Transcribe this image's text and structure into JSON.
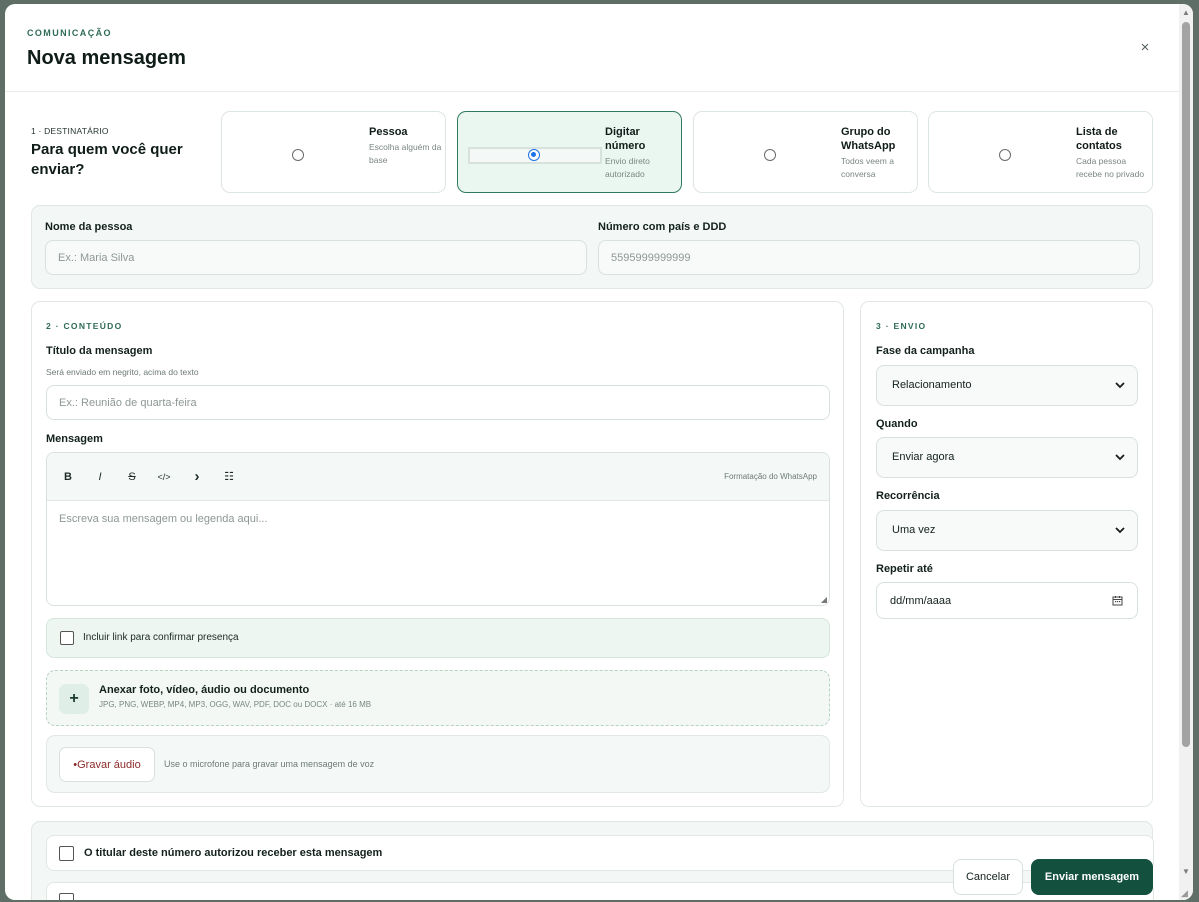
{
  "header": {
    "eyebrow": "COMUNICAÇÃO",
    "title": "Nova mensagem",
    "close": "×"
  },
  "recipient": {
    "step_label": "1 · DESTINATÁRIO",
    "question": "Para quem você quer enviar?",
    "options": [
      {
        "title": "Pessoa",
        "subtitle": "Escolha alguém da base",
        "selected": false
      },
      {
        "title": "Digitar número",
        "subtitle": "Envio direto autorizado",
        "selected": true
      },
      {
        "title": "Grupo do WhatsApp",
        "subtitle": "Todos veem a conversa",
        "selected": false
      },
      {
        "title": "Lista de contatos",
        "subtitle": "Cada pessoa recebe no privado",
        "selected": false
      }
    ],
    "name_label": "Nome da pessoa",
    "name_placeholder": "Ex.: Maria Silva",
    "number_label": "Número com país e DDD",
    "number_placeholder": "5595999999999"
  },
  "content": {
    "eyebrow": "2 · CONTEÚDO",
    "title_label": "Título da mensagem",
    "title_help": "Será enviado em negrito, acima do texto",
    "title_placeholder": "Ex.: Reunião de quarta-feira",
    "message_label": "Mensagem",
    "toolbar": {
      "bold": "B",
      "italic": "I",
      "strike": "S",
      "code": "</>",
      "quote": "›",
      "list": "☷",
      "hint": "Formatação do WhatsApp"
    },
    "message_placeholder": "Escreva sua mensagem ou legenda aqui...",
    "rsvp_label": "Incluir link para confirmar presença",
    "attach_title": "Anexar foto, vídeo, áudio ou documento",
    "attach_help": "JPG, PNG, WEBP, MP4, MP3, OGG, WAV, PDF, DOC ou DOCX · até 16 MB",
    "attach_plus": "+",
    "record_button": "•Gravar áudio",
    "record_help": "Use o microfone para gravar uma mensagem de voz"
  },
  "send": {
    "eyebrow": "3 · ENVIO",
    "phase_label": "Fase da campanha",
    "phase_value": "Relacionamento",
    "when_label": "Quando",
    "when_value": "Enviar agora",
    "recurrence_label": "Recorrência",
    "recurrence_value": "Uma vez",
    "repeat_label": "Repetir até",
    "repeat_placeholder": "dd/mm/aaaa"
  },
  "footer": {
    "consent_label": "O titular deste número autorizou receber esta mensagem",
    "cancel": "Cancelar",
    "submit": "Enviar mensagem"
  },
  "colors": {
    "accent": "#13503e",
    "selected_bg": "#eaf6f0",
    "eyebrow": "#2f6b57"
  }
}
